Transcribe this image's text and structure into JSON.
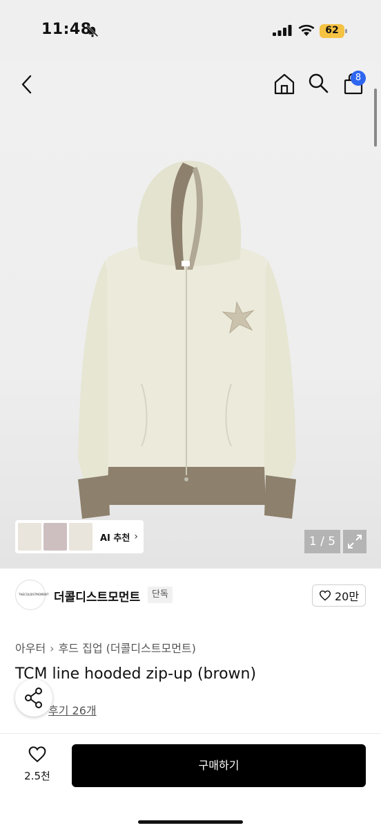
{
  "status_bar": {
    "time": "11:48",
    "battery": "62"
  },
  "header": {
    "cart_count": "8"
  },
  "gallery": {
    "ai_recommend_label": "AI 추천",
    "page_indicator": "1 / 5"
  },
  "brand": {
    "logo_text": "THECOLDISTMOMENT",
    "name": "더콜디스트모먼트",
    "tag": "단독",
    "favorite_count": "20만"
  },
  "product": {
    "breadcrumb": [
      "아우터",
      "후드 집업 (더콜디스트모먼트)"
    ],
    "title": "TCM line hooded zip-up (brown)",
    "reviews": "후기 26개"
  },
  "bottom_bar": {
    "like_count": "2.5천",
    "buy_label": "구매하기"
  }
}
